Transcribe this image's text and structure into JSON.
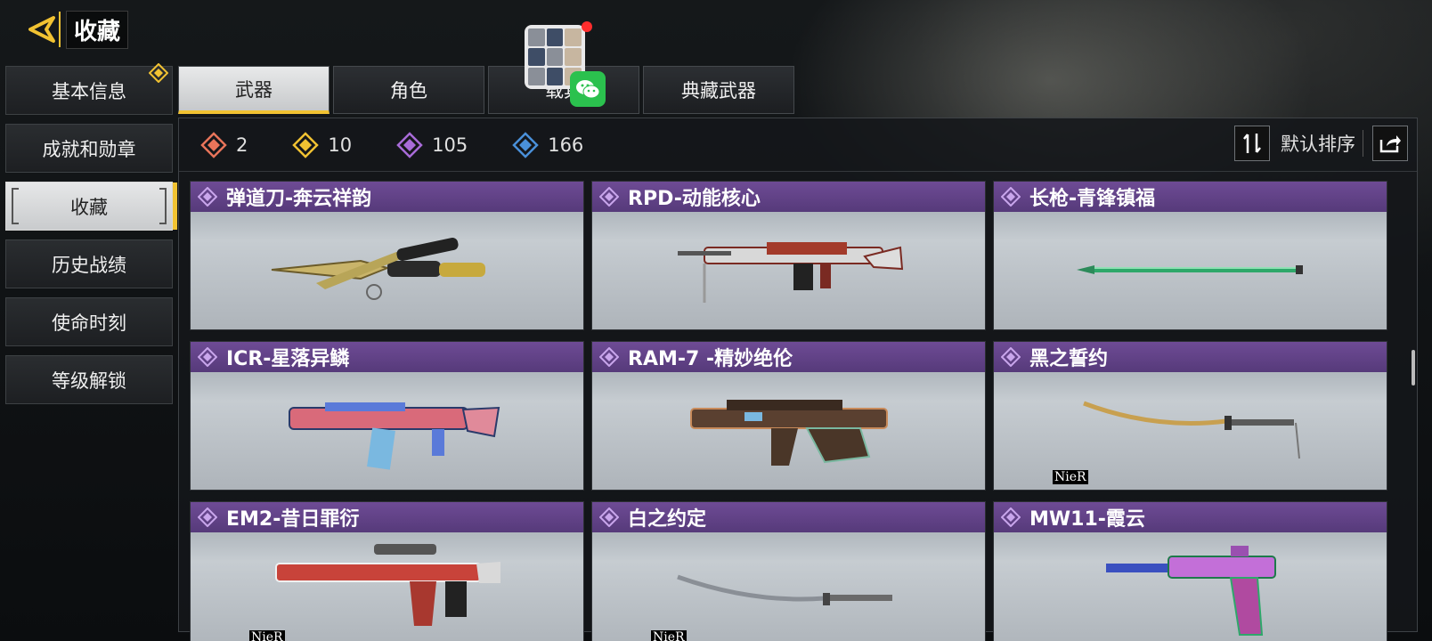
{
  "header": {
    "title": "收藏"
  },
  "sidebar": {
    "items": [
      {
        "label": "基本信息"
      },
      {
        "label": "成就和勋章"
      },
      {
        "label": "收藏"
      },
      {
        "label": "历史战绩"
      },
      {
        "label": "使命时刻"
      },
      {
        "label": "等级解锁"
      }
    ]
  },
  "tabs": [
    {
      "label": "武器"
    },
    {
      "label": "角色"
    },
    {
      "label": "载具"
    },
    {
      "label": "典藏武器"
    }
  ],
  "stats": [
    {
      "value": "2",
      "color": "#e8745a"
    },
    {
      "value": "10",
      "color": "#f1c232"
    },
    {
      "value": "105",
      "color": "#a86bd8"
    },
    {
      "value": "166",
      "color": "#4a90d9"
    }
  ],
  "sort": {
    "label": "默认排序"
  },
  "cards": [
    {
      "name": "弹道刀-奔云祥韵",
      "icon": "knife",
      "tag": ""
    },
    {
      "name": "RPD-动能核心",
      "icon": "lmg",
      "tag": ""
    },
    {
      "name": "长枪-青锋镇福",
      "icon": "spear",
      "tag": ""
    },
    {
      "name": "ICR-星落异鳞",
      "icon": "rifle",
      "tag": ""
    },
    {
      "name": "RAM-7 -精妙绝伦",
      "icon": "bullpup",
      "tag": ""
    },
    {
      "name": "黑之誓约",
      "icon": "katana",
      "tag": "NieR"
    },
    {
      "name": "EM2-昔日罪衍",
      "icon": "rifle2",
      "tag": "NieR"
    },
    {
      "name": "白之约定",
      "icon": "katana2",
      "tag": "NieR"
    },
    {
      "name": "MW11-霞云",
      "icon": "pistol",
      "tag": ""
    }
  ],
  "colors": {
    "accent": "#f1c232",
    "card_header": "#6e4b95",
    "active_tab": "#e8e9ea"
  }
}
